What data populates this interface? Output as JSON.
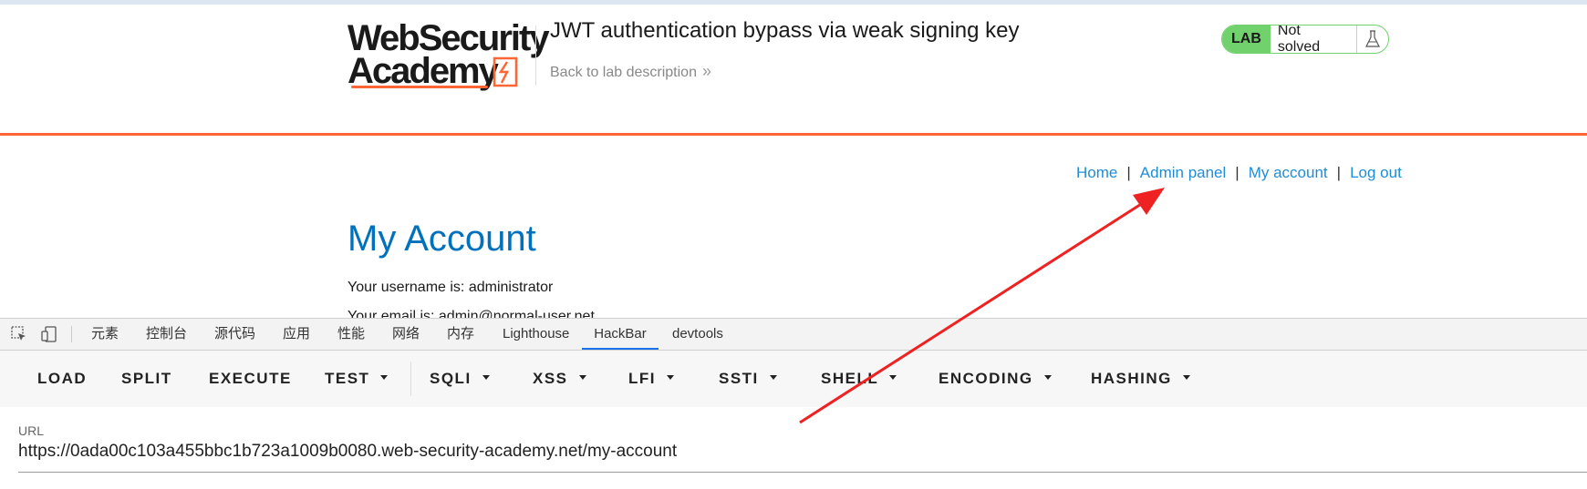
{
  "lab": {
    "logo_line1": "WebSecurity",
    "logo_line2": "Academy",
    "title": "JWT authentication bypass via weak signing key",
    "back_link": "Back to lab description",
    "badge": "LAB",
    "status": "Not solved",
    "accent": "#ff6633",
    "status_color": "#70d16d"
  },
  "nav": {
    "home": "Home",
    "admin": "Admin panel",
    "account": "My account",
    "logout": "Log out",
    "separator": "|"
  },
  "page": {
    "heading": "My Account",
    "username_line": "Your username is: administrator",
    "email_line": "Your email is: admin@normal-user.net"
  },
  "devtools": {
    "tabs": [
      "元素",
      "控制台",
      "源代码",
      "应用",
      "性能",
      "网络",
      "内存",
      "Lighthouse",
      "HackBar",
      "devtools"
    ],
    "active_tab": "HackBar"
  },
  "hackbar": {
    "load": "LOAD",
    "split": "SPLIT",
    "execute": "EXECUTE",
    "test": "TEST",
    "sqli": "SQLI",
    "xss": "XSS",
    "lfi": "LFI",
    "ssti": "SSTI",
    "shell": "SHELL",
    "encoding": "ENCODING",
    "hashing": "HASHING",
    "url_label": "URL",
    "url_value": "https://0ada00c103a455bbc1b723a1009b0080.web-security-academy.net/my-account"
  },
  "annotation": {
    "arrow_color": "#ee2222"
  }
}
